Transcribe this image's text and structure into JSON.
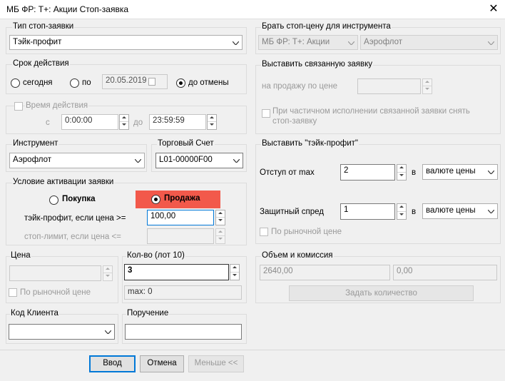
{
  "window": {
    "title": "МБ ФР: Т+: Акции Стоп-заявка",
    "close_icon": "close-icon"
  },
  "order_type": {
    "legend": "Тип стоп-заявки",
    "value": "Тэйк-профит"
  },
  "validity": {
    "legend": "Срок действия",
    "today": "сегодня",
    "until": "по",
    "date": "20.05.2019",
    "until_cancel": "до отмены",
    "selected": "до отмены"
  },
  "time": {
    "legend": "Время действия",
    "from_label": "с",
    "from": "0:00:00",
    "to_label": "до",
    "to": "23:59:59"
  },
  "instrument": {
    "label": "Инструмент",
    "value": "Аэрофлот"
  },
  "account": {
    "label": "Торговый Счет",
    "value": "L01-00000F00"
  },
  "activation": {
    "legend": "Условие активации заявки",
    "buy": "Покупка",
    "sell": "Продажа",
    "selected": "Продажа",
    "tp_label": "тэйк-профит, если цена >=",
    "tp_value": "100,00",
    "sl_label": "стоп-лимит, если цена <=",
    "sl_value": ""
  },
  "price": {
    "legend": "Цена",
    "value": "",
    "market": "По рыночной цене"
  },
  "qty": {
    "legend": "Кол-во (лот 10)",
    "value": "3",
    "max": "max: 0"
  },
  "client": {
    "legend": "Код Клиента",
    "value": ""
  },
  "comment": {
    "legend": "Поручение",
    "value": ""
  },
  "stop_source": {
    "legend": "Брать стоп-цену для инструмента",
    "class": "МБ ФР: Т+: Акции",
    "instrument": "Аэрофлот"
  },
  "linked": {
    "legend": "Выставить связанную заявку",
    "sell_price": "на продажу по цене",
    "value": "",
    "cancel_on_partial": "При частичном исполнении связанной заявки снять стоп-заявку"
  },
  "take_profit": {
    "legend": "Выставить \"тэйк-профит\"",
    "offset_label": "Отступ от max",
    "offset_value": "2",
    "in": "в",
    "offset_unit": "валюте цены",
    "spread_label": "Защитный спред",
    "spread_value": "1",
    "spread_unit": "валюте цены",
    "market": "По рыночной цене"
  },
  "volume": {
    "legend": "Объем и комиссия",
    "amount": "2640,00",
    "commission": "0,00",
    "set_qty": "Задать количество"
  },
  "buttons": {
    "submit": "Ввод",
    "cancel": "Отмена",
    "less": "Меньше <<"
  },
  "colors": {
    "sell_bg": "#f2594b",
    "accent": "#0078d7"
  }
}
